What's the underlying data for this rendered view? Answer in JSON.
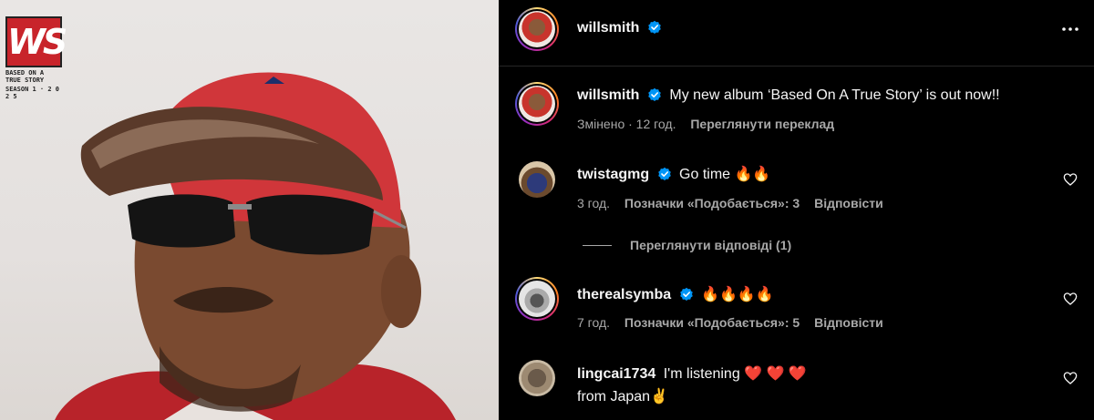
{
  "post": {
    "media_logo": {
      "text": "WS",
      "sub_line1": "BASED ON A TRUE STORY",
      "sub_line2": "SEASON 1 · 2 0 2 5"
    }
  },
  "header": {
    "username": "willsmith",
    "verified": true,
    "more_icon": "more-horizontal-icon"
  },
  "caption": {
    "username": "willsmith",
    "text": "My new album ‘Based On A True Story’ is out now!!",
    "edited_time": "Змінено · 12 год.",
    "translate_label": "Переглянути переклад"
  },
  "comments": [
    {
      "username": "twistagmg",
      "verified": true,
      "text": "Go time 🔥🔥",
      "time": "3 год.",
      "likes": "Позначки «Подобається»: 3",
      "reply_label": "Відповісти",
      "view_replies": "Переглянути відповіді (1)"
    },
    {
      "username": "therealsymba",
      "verified": true,
      "text": "🔥🔥🔥🔥",
      "time": "7 год.",
      "likes": "Позначки «Подобається»: 5",
      "reply_label": "Відповісти"
    },
    {
      "username": "lingcai1734",
      "verified": false,
      "text_line1": "I'm listening ❤️ ❤️ ❤️",
      "text_line2": "from Japan✌️"
    }
  ],
  "colors": {
    "background": "#000000",
    "verified_blue": "#0095f6",
    "meta_gray": "#a8a8a8",
    "cap_red": "#c8242b"
  }
}
